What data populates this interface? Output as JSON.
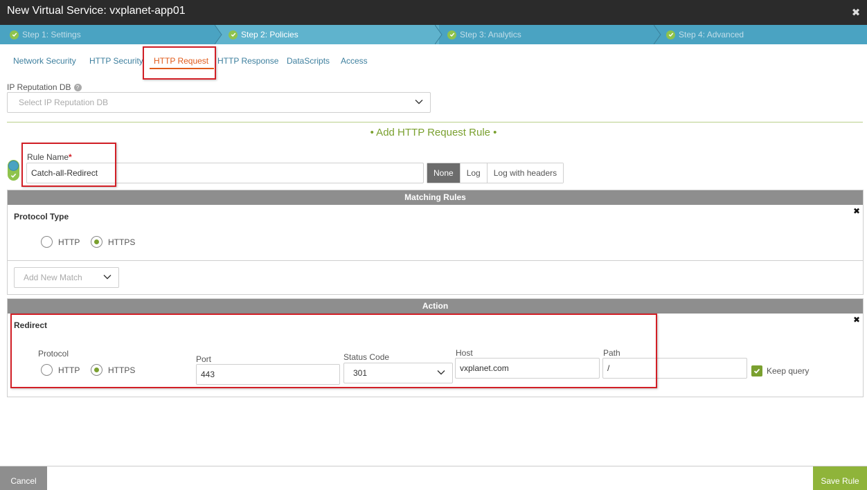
{
  "window": {
    "title": "New Virtual Service: vxplanet-app01",
    "close_icon": "close-icon"
  },
  "steps": [
    {
      "label": "Step 1: Settings",
      "done": true
    },
    {
      "label": "Step 2: Policies",
      "done": true,
      "active": true
    },
    {
      "label": "Step 3: Analytics",
      "done": true
    },
    {
      "label": "Step 4: Advanced",
      "done": true
    }
  ],
  "tabs": [
    {
      "label": "Network Security"
    },
    {
      "label": "HTTP Security"
    },
    {
      "label": "HTTP Request",
      "active": true
    },
    {
      "label": "HTTP Response"
    },
    {
      "label": "DataScripts"
    },
    {
      "label": "Access"
    }
  ],
  "ip_reputation": {
    "label": "IP Reputation DB",
    "help": "?",
    "placeholder": "Select IP Reputation DB"
  },
  "add_rule": {
    "title": "• Add HTTP Request Rule •"
  },
  "rule": {
    "name_label": "Rule Name",
    "required_mark": "*",
    "name_value": "Catch-all-Redirect",
    "log_options": [
      "None",
      "Log",
      "Log with headers"
    ],
    "log_selected": "None"
  },
  "matching": {
    "header": "Matching Rules",
    "close": "✖",
    "protocol_title": "Protocol Type",
    "protocols": [
      "HTTP",
      "HTTPS"
    ],
    "protocol_selected": "HTTPS",
    "add_match_placeholder": "Add New Match"
  },
  "action": {
    "header": "Action",
    "close": "✖",
    "title": "Redirect",
    "protocol_label": "Protocol",
    "protocols": [
      "HTTP",
      "HTTPS"
    ],
    "protocol_selected": "HTTPS",
    "port_label": "Port",
    "port_value": "443",
    "status_label": "Status Code",
    "status_value": "301",
    "host_label": "Host",
    "host_value": "vxplanet.com",
    "path_label": "Path",
    "path_value": "/",
    "keep_query_label": "Keep query",
    "keep_query_checked": true
  },
  "footer": {
    "cancel": "Cancel",
    "save": "Save Rule"
  },
  "colors": {
    "accent_green": "#7aa02f",
    "step_blue": "#4aa3c2",
    "active_tab": "#e05a1a",
    "highlight_red": "#d21f26"
  }
}
